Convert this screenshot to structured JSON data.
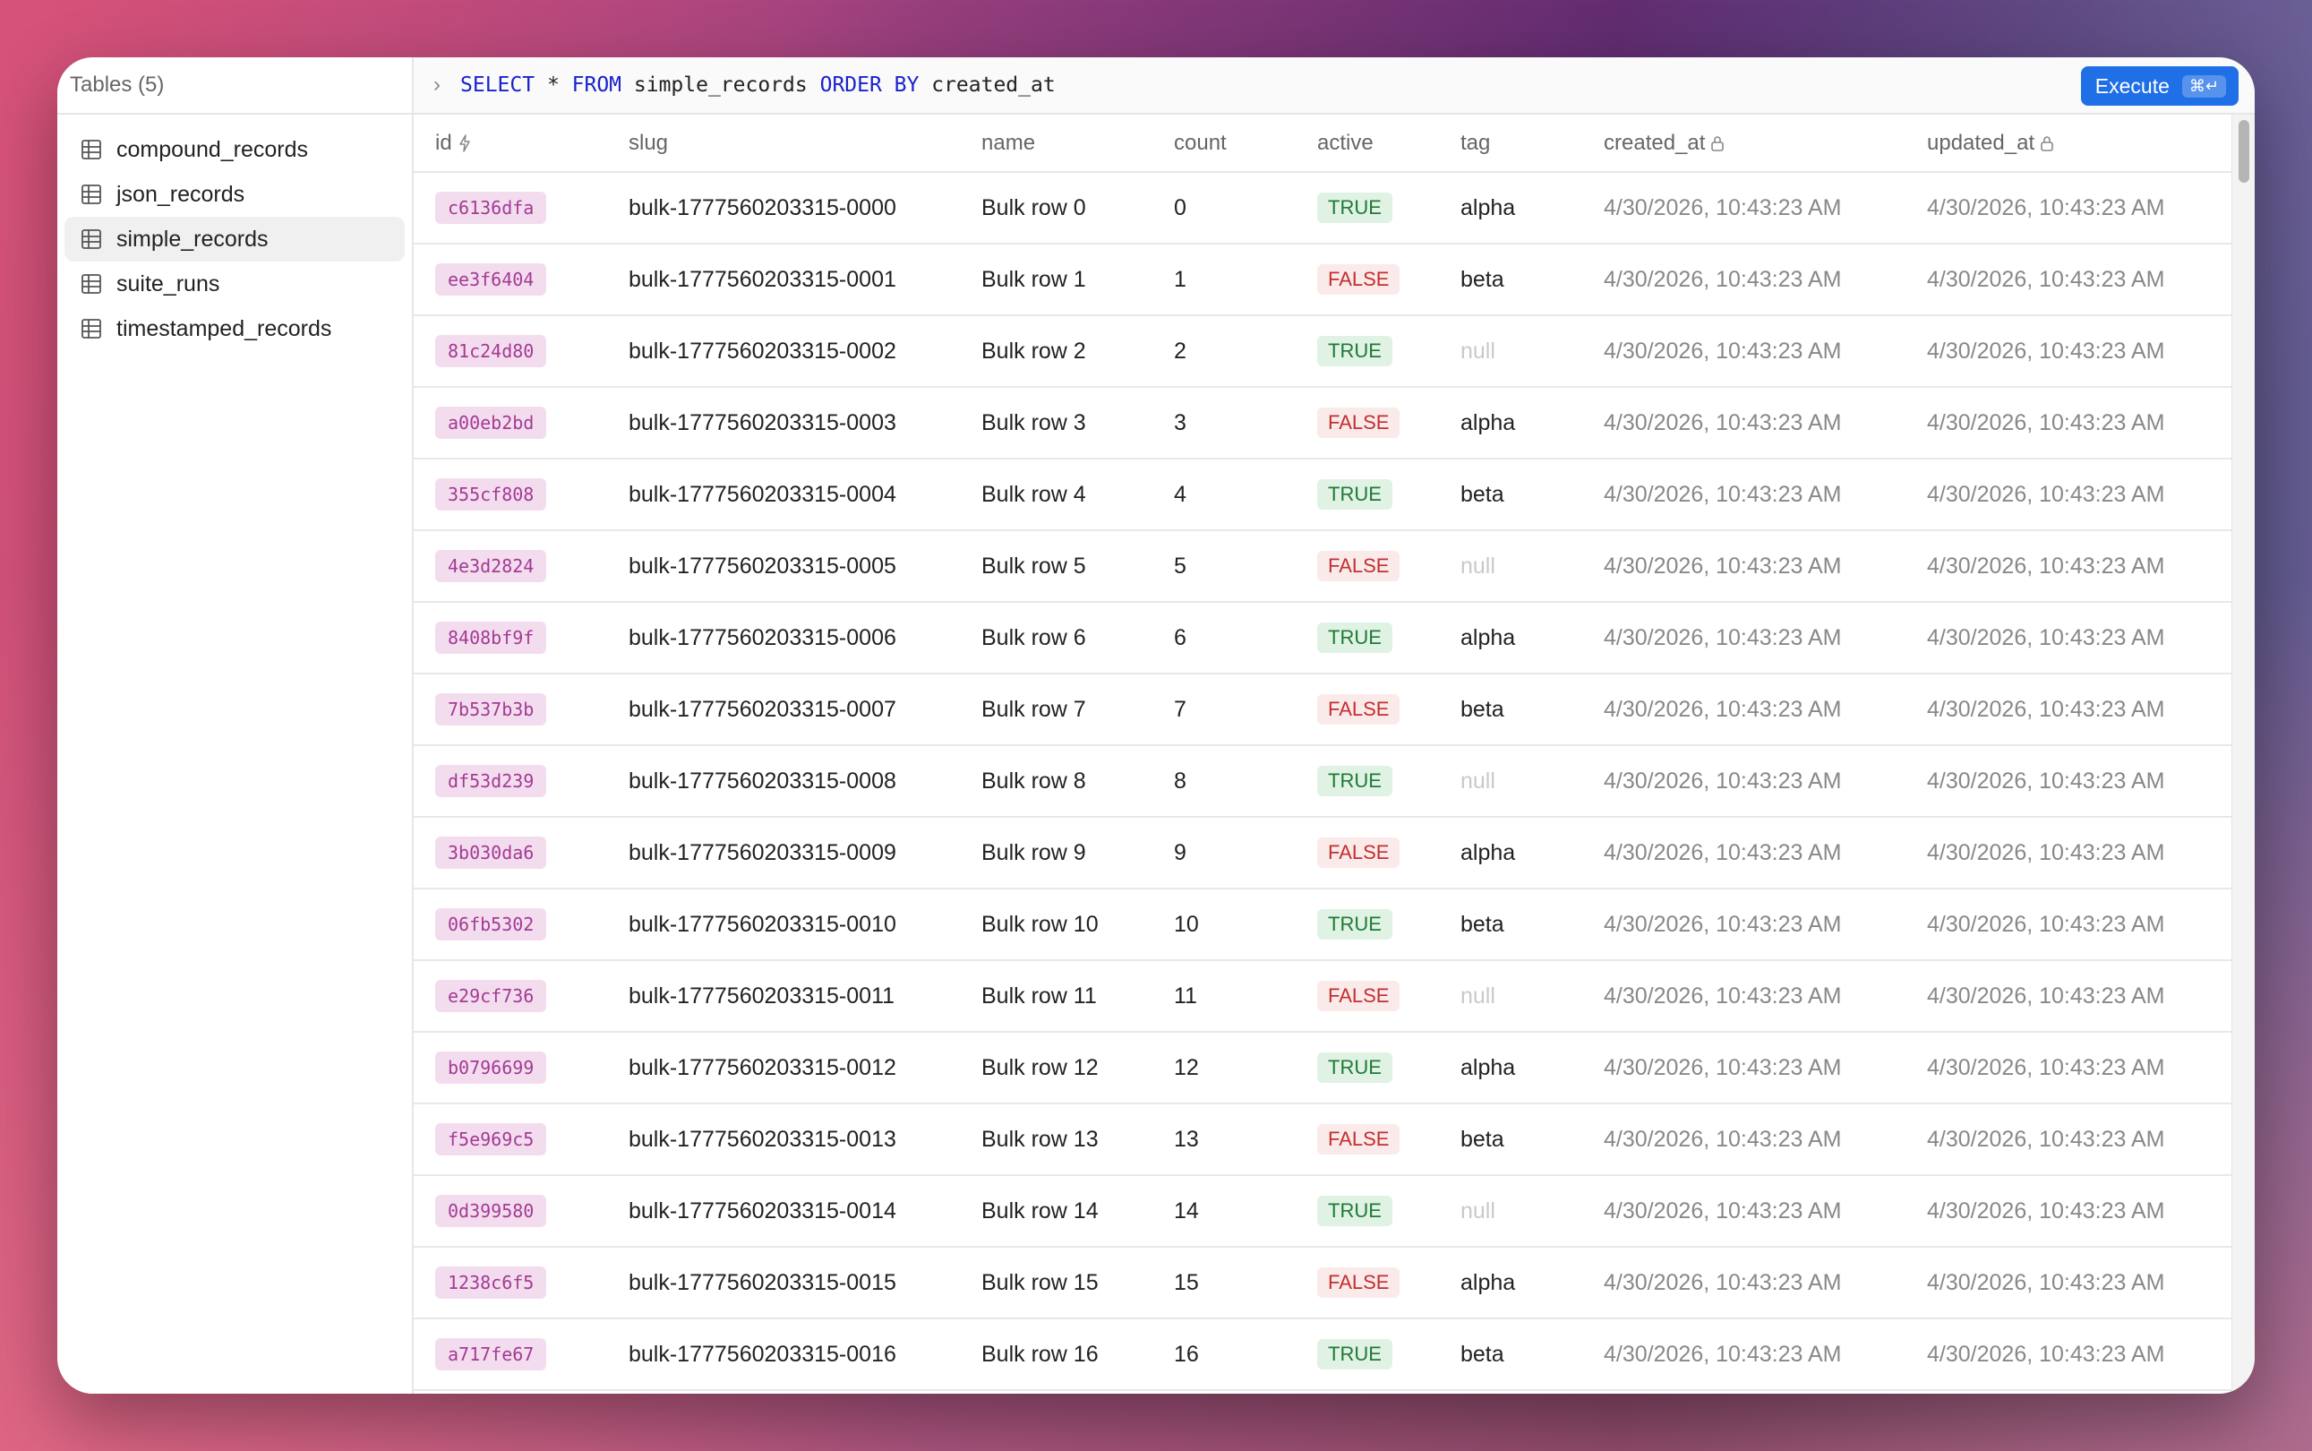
{
  "sidebar": {
    "title": "Tables (5)",
    "items": [
      {
        "label": "compound_records"
      },
      {
        "label": "json_records"
      },
      {
        "label": "simple_records"
      },
      {
        "label": "suite_runs"
      },
      {
        "label": "timestamped_records"
      }
    ],
    "active_index": 2
  },
  "query": {
    "kw1": "SELECT",
    "mid1": " * ",
    "kw2": "FROM",
    "mid2": " simple_records ",
    "kw3": "ORDER BY",
    "mid3": " created_at",
    "execute_label": "Execute",
    "shortcut": "⌘↵"
  },
  "columns": [
    {
      "label": "id",
      "icon": "bolt-icon"
    },
    {
      "label": "slug"
    },
    {
      "label": "name"
    },
    {
      "label": "count"
    },
    {
      "label": "active"
    },
    {
      "label": "tag"
    },
    {
      "label": "created_at",
      "icon": "lock-icon"
    },
    {
      "label": "updated_at",
      "icon": "lock-icon"
    }
  ],
  "rows": [
    {
      "id": "c6136dfa",
      "slug": "bulk-1777560203315-0000",
      "name": "Bulk row 0",
      "count": "0",
      "active": "TRUE",
      "tag": "alpha",
      "created_at": "4/30/2026, 10:43:23 AM",
      "updated_at": "4/30/2026, 10:43:23 AM"
    },
    {
      "id": "ee3f6404",
      "slug": "bulk-1777560203315-0001",
      "name": "Bulk row 1",
      "count": "1",
      "active": "FALSE",
      "tag": "beta",
      "created_at": "4/30/2026, 10:43:23 AM",
      "updated_at": "4/30/2026, 10:43:23 AM"
    },
    {
      "id": "81c24d80",
      "slug": "bulk-1777560203315-0002",
      "name": "Bulk row 2",
      "count": "2",
      "active": "TRUE",
      "tag": "null",
      "created_at": "4/30/2026, 10:43:23 AM",
      "updated_at": "4/30/2026, 10:43:23 AM"
    },
    {
      "id": "a00eb2bd",
      "slug": "bulk-1777560203315-0003",
      "name": "Bulk row 3",
      "count": "3",
      "active": "FALSE",
      "tag": "alpha",
      "created_at": "4/30/2026, 10:43:23 AM",
      "updated_at": "4/30/2026, 10:43:23 AM"
    },
    {
      "id": "355cf808",
      "slug": "bulk-1777560203315-0004",
      "name": "Bulk row 4",
      "count": "4",
      "active": "TRUE",
      "tag": "beta",
      "created_at": "4/30/2026, 10:43:23 AM",
      "updated_at": "4/30/2026, 10:43:23 AM"
    },
    {
      "id": "4e3d2824",
      "slug": "bulk-1777560203315-0005",
      "name": "Bulk row 5",
      "count": "5",
      "active": "FALSE",
      "tag": "null",
      "created_at": "4/30/2026, 10:43:23 AM",
      "updated_at": "4/30/2026, 10:43:23 AM"
    },
    {
      "id": "8408bf9f",
      "slug": "bulk-1777560203315-0006",
      "name": "Bulk row 6",
      "count": "6",
      "active": "TRUE",
      "tag": "alpha",
      "created_at": "4/30/2026, 10:43:23 AM",
      "updated_at": "4/30/2026, 10:43:23 AM"
    },
    {
      "id": "7b537b3b",
      "slug": "bulk-1777560203315-0007",
      "name": "Bulk row 7",
      "count": "7",
      "active": "FALSE",
      "tag": "beta",
      "created_at": "4/30/2026, 10:43:23 AM",
      "updated_at": "4/30/2026, 10:43:23 AM"
    },
    {
      "id": "df53d239",
      "slug": "bulk-1777560203315-0008",
      "name": "Bulk row 8",
      "count": "8",
      "active": "TRUE",
      "tag": "null",
      "created_at": "4/30/2026, 10:43:23 AM",
      "updated_at": "4/30/2026, 10:43:23 AM"
    },
    {
      "id": "3b030da6",
      "slug": "bulk-1777560203315-0009",
      "name": "Bulk row 9",
      "count": "9",
      "active": "FALSE",
      "tag": "alpha",
      "created_at": "4/30/2026, 10:43:23 AM",
      "updated_at": "4/30/2026, 10:43:23 AM"
    },
    {
      "id": "06fb5302",
      "slug": "bulk-1777560203315-0010",
      "name": "Bulk row 10",
      "count": "10",
      "active": "TRUE",
      "tag": "beta",
      "created_at": "4/30/2026, 10:43:23 AM",
      "updated_at": "4/30/2026, 10:43:23 AM"
    },
    {
      "id": "e29cf736",
      "slug": "bulk-1777560203315-0011",
      "name": "Bulk row 11",
      "count": "11",
      "active": "FALSE",
      "tag": "null",
      "created_at": "4/30/2026, 10:43:23 AM",
      "updated_at": "4/30/2026, 10:43:23 AM"
    },
    {
      "id": "b0796699",
      "slug": "bulk-1777560203315-0012",
      "name": "Bulk row 12",
      "count": "12",
      "active": "TRUE",
      "tag": "alpha",
      "created_at": "4/30/2026, 10:43:23 AM",
      "updated_at": "4/30/2026, 10:43:23 AM"
    },
    {
      "id": "f5e969c5",
      "slug": "bulk-1777560203315-0013",
      "name": "Bulk row 13",
      "count": "13",
      "active": "FALSE",
      "tag": "beta",
      "created_at": "4/30/2026, 10:43:23 AM",
      "updated_at": "4/30/2026, 10:43:23 AM"
    },
    {
      "id": "0d399580",
      "slug": "bulk-1777560203315-0014",
      "name": "Bulk row 14",
      "count": "14",
      "active": "TRUE",
      "tag": "null",
      "created_at": "4/30/2026, 10:43:23 AM",
      "updated_at": "4/30/2026, 10:43:23 AM"
    },
    {
      "id": "1238c6f5",
      "slug": "bulk-1777560203315-0015",
      "name": "Bulk row 15",
      "count": "15",
      "active": "FALSE",
      "tag": "alpha",
      "created_at": "4/30/2026, 10:43:23 AM",
      "updated_at": "4/30/2026, 10:43:23 AM"
    },
    {
      "id": "a717fe67",
      "slug": "bulk-1777560203315-0016",
      "name": "Bulk row 16",
      "count": "16",
      "active": "TRUE",
      "tag": "beta",
      "created_at": "4/30/2026, 10:43:23 AM",
      "updated_at": "4/30/2026, 10:43:23 AM"
    }
  ],
  "colors": {
    "accent": "#1f6fe6",
    "id_pill_bg": "#f4dcef",
    "id_pill_text": "#a23b94",
    "true_bg": "#e0f2e4",
    "true_text": "#1f7a37",
    "false_bg": "#fbeaea",
    "false_text": "#c22f2f"
  }
}
